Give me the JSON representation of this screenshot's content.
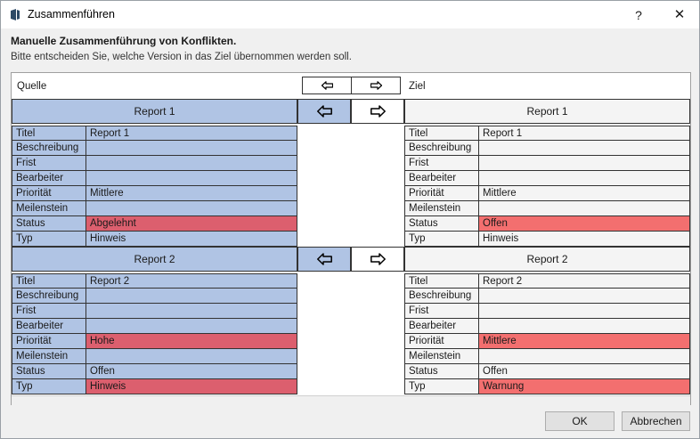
{
  "window": {
    "title": "Zusammenführen",
    "help_glyph": "?",
    "close_glyph": "✕"
  },
  "heading": "Manuelle Zusammenführung von Konflikten.",
  "subheading": "Bitte entscheiden Sie, welche Version in das Ziel übernommen werden soll.",
  "columns": {
    "source": "Quelle",
    "target": "Ziel"
  },
  "icons": {
    "arrow_left": "arrow-left-icon",
    "arrow_right": "arrow-right-icon"
  },
  "colors": {
    "source_bg": "#b0c4e4",
    "target_bg": "#f4f4f4",
    "conflict_source": "#dc5f6e",
    "conflict_target": "#f36f6f"
  },
  "reports": [
    {
      "source": {
        "title": "Report 1",
        "fields": [
          {
            "label": "Titel",
            "value": "Report 1",
            "conflict": false
          },
          {
            "label": "Beschreibung",
            "value": "",
            "conflict": false
          },
          {
            "label": "Frist",
            "value": "",
            "conflict": false
          },
          {
            "label": "Bearbeiter",
            "value": "",
            "conflict": false
          },
          {
            "label": "Priorität",
            "value": "Mittlere",
            "conflict": false
          },
          {
            "label": "Meilenstein",
            "value": "",
            "conflict": false
          },
          {
            "label": "Status",
            "value": "Abgelehnt",
            "conflict": true
          },
          {
            "label": "Typ",
            "value": "Hinweis",
            "conflict": false
          }
        ]
      },
      "target": {
        "title": "Report 1",
        "fields": [
          {
            "label": "Titel",
            "value": "Report 1",
            "conflict": false
          },
          {
            "label": "Beschreibung",
            "value": "",
            "conflict": false
          },
          {
            "label": "Frist",
            "value": "",
            "conflict": false
          },
          {
            "label": "Bearbeiter",
            "value": "",
            "conflict": false
          },
          {
            "label": "Priorität",
            "value": "Mittlere",
            "conflict": false
          },
          {
            "label": "Meilenstein",
            "value": "",
            "conflict": false
          },
          {
            "label": "Status",
            "value": "Offen",
            "conflict": true
          },
          {
            "label": "Typ",
            "value": "Hinweis",
            "conflict": false
          }
        ]
      }
    },
    {
      "source": {
        "title": "Report 2",
        "fields": [
          {
            "label": "Titel",
            "value": "Report 2",
            "conflict": false
          },
          {
            "label": "Beschreibung",
            "value": "",
            "conflict": false
          },
          {
            "label": "Frist",
            "value": "",
            "conflict": false
          },
          {
            "label": "Bearbeiter",
            "value": "",
            "conflict": false
          },
          {
            "label": "Priorität",
            "value": "Hohe",
            "conflict": true
          },
          {
            "label": "Meilenstein",
            "value": "",
            "conflict": false
          },
          {
            "label": "Status",
            "value": "Offen",
            "conflict": false
          },
          {
            "label": "Typ",
            "value": "Hinweis",
            "conflict": true
          }
        ]
      },
      "target": {
        "title": "Report 2",
        "fields": [
          {
            "label": "Titel",
            "value": "Report 2",
            "conflict": false
          },
          {
            "label": "Beschreibung",
            "value": "",
            "conflict": false
          },
          {
            "label": "Frist",
            "value": "",
            "conflict": false
          },
          {
            "label": "Bearbeiter",
            "value": "",
            "conflict": false
          },
          {
            "label": "Priorität",
            "value": "Mittlere",
            "conflict": true
          },
          {
            "label": "Meilenstein",
            "value": "",
            "conflict": false
          },
          {
            "label": "Status",
            "value": "Offen",
            "conflict": false
          },
          {
            "label": "Typ",
            "value": "Warnung",
            "conflict": true
          }
        ]
      }
    }
  ],
  "buttons": {
    "ok": "OK",
    "cancel": "Abbrechen"
  }
}
